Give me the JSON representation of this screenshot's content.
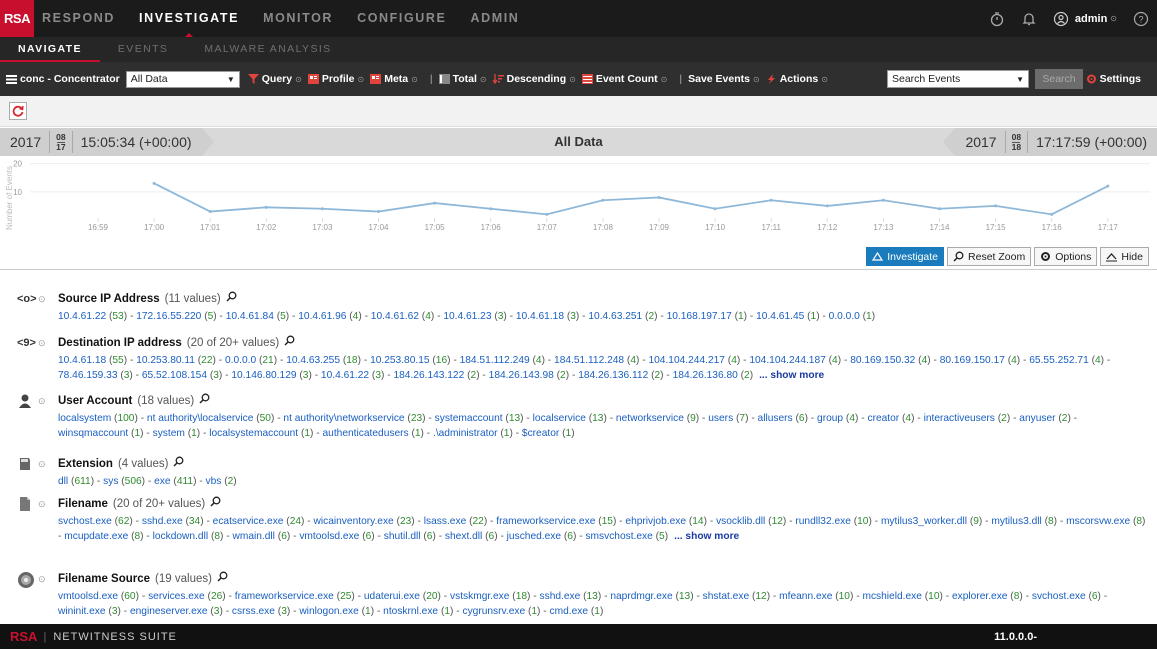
{
  "brand": {
    "logo": "RSA",
    "product": "NETWITNESS SUITE",
    "version": "11.0.0.0-"
  },
  "topnav": {
    "tabs": [
      {
        "label": "RESPOND",
        "active": false
      },
      {
        "label": "INVESTIGATE",
        "active": true
      },
      {
        "label": "MONITOR",
        "active": false
      },
      {
        "label": "CONFIGURE",
        "active": false
      },
      {
        "label": "ADMIN",
        "active": false
      }
    ],
    "user": "admin"
  },
  "subnav": {
    "tabs": [
      {
        "label": "NAVIGATE",
        "active": true
      },
      {
        "label": "EVENTS",
        "active": false
      },
      {
        "label": "MALWARE ANALYSIS",
        "active": false
      }
    ]
  },
  "toolbar": {
    "device": "conc - Concentrator",
    "data_select": "All Data",
    "query": "Query",
    "profile": "Profile",
    "meta": "Meta",
    "total": "Total",
    "order": "Descending",
    "event_count": "Event Count",
    "save_events": "Save Events",
    "actions": "Actions",
    "search_placeholder": "Search Events",
    "search_button": "Search",
    "settings": "Settings"
  },
  "timebar": {
    "start": {
      "year": "2017",
      "month": "08",
      "day": "17",
      "time": "15:05:34 (+00:00)"
    },
    "end": {
      "year": "2017",
      "month": "08",
      "day": "18",
      "time": "17:17:59 (+00:00)"
    },
    "center_label": "All Data"
  },
  "chart_data": {
    "type": "line",
    "ylabel": "Number of Events",
    "yticks": [
      10,
      20
    ],
    "ylim": [
      0,
      22
    ],
    "x": [
      "16:59",
      "17:00",
      "17:01",
      "17:02",
      "17:03",
      "17:04",
      "17:05",
      "17:06",
      "17:07",
      "17:08",
      "17:09",
      "17:10",
      "17:11",
      "17:12",
      "17:13",
      "17:14",
      "17:15",
      "17:16",
      "17:17"
    ],
    "values": [
      null,
      13,
      3,
      4.5,
      4,
      3,
      6,
      4,
      2,
      7,
      8,
      4,
      7,
      5,
      7,
      4,
      5,
      2,
      12
    ],
    "color": "#8fb8d8"
  },
  "chart_buttons": {
    "investigate": "Investigate",
    "reset_zoom": "Reset Zoom",
    "options": "Options",
    "hide": "Hide"
  },
  "meta_groups": [
    {
      "icon": "source-ip-icon",
      "title": "Source IP Address",
      "count": "(11 values)",
      "values": [
        [
          "10.4.61.22",
          "53"
        ],
        [
          "172.16.55.220",
          "5"
        ],
        [
          "10.4.61.84",
          "5"
        ],
        [
          "10.4.61.96",
          "4"
        ],
        [
          "10.4.61.62",
          "4"
        ],
        [
          "10.4.61.23",
          "3"
        ],
        [
          "10.4.61.18",
          "3"
        ],
        [
          "10.4.63.251",
          "2"
        ],
        [
          "10.168.197.17",
          "1"
        ],
        [
          "10.4.61.45",
          "1"
        ],
        [
          "0.0.0.0",
          "1"
        ]
      ],
      "show_more": ""
    },
    {
      "icon": "destination-ip-icon",
      "title": "Destination IP address",
      "count": "(20 of 20+ values)",
      "values": [
        [
          "10.4.61.18",
          "55"
        ],
        [
          "10.253.80.11",
          "22"
        ],
        [
          "0.0.0.0",
          "21"
        ],
        [
          "10.4.63.255",
          "18"
        ],
        [
          "10.253.80.15",
          "16"
        ],
        [
          "184.51.112.249",
          "4"
        ],
        [
          "184.51.112.248",
          "4"
        ],
        [
          "104.104.244.217",
          "4"
        ],
        [
          "104.104.244.187",
          "4"
        ],
        [
          "80.169.150.32",
          "4"
        ],
        [
          "80.169.150.17",
          "4"
        ],
        [
          "65.55.252.71",
          "4"
        ],
        [
          "78.46.159.33",
          "3"
        ],
        [
          "65.52.108.154",
          "3"
        ],
        [
          "10.146.80.129",
          "3"
        ],
        [
          "10.4.61.22",
          "3"
        ],
        [
          "184.26.143.122",
          "2"
        ],
        [
          "184.26.143.98",
          "2"
        ],
        [
          "184.26.136.112",
          "2"
        ],
        [
          "184.26.136.80",
          "2"
        ]
      ],
      "show_more": "... show more"
    },
    {
      "icon": "user-icon",
      "title": "User Account",
      "count": "(18 values)",
      "values": [
        [
          "localsystem",
          "100"
        ],
        [
          "nt authority\\localservice",
          "50"
        ],
        [
          "nt authority\\networkservice",
          "23"
        ],
        [
          "systemaccount",
          "13"
        ],
        [
          "localservice",
          "13"
        ],
        [
          "networkservice",
          "9"
        ],
        [
          "users",
          "7"
        ],
        [
          "allusers",
          "6"
        ],
        [
          "group",
          "4"
        ],
        [
          "creator",
          "4"
        ],
        [
          "interactiveusers",
          "2"
        ],
        [
          "anyuser",
          "2"
        ],
        [
          "winsqmaccount",
          "1"
        ],
        [
          "system",
          "1"
        ],
        [
          "localsystemaccount",
          "1"
        ],
        [
          "authenticatedusers",
          "1"
        ],
        [
          ".\\administrator",
          "1"
        ],
        [
          "$creator",
          "1"
        ]
      ],
      "show_more": ""
    },
    {
      "icon": "extension-icon",
      "title": "Extension",
      "count": "(4 values)",
      "values": [
        [
          "dll",
          "611"
        ],
        [
          "sys",
          "506"
        ],
        [
          "exe",
          "411"
        ],
        [
          "vbs",
          "2"
        ]
      ],
      "show_more": ""
    },
    {
      "icon": "file-icon",
      "title": "Filename",
      "count": "(20 of 20+ values)",
      "values": [
        [
          "svchost.exe",
          "62"
        ],
        [
          "sshd.exe",
          "34"
        ],
        [
          "ecatservice.exe",
          "24"
        ],
        [
          "wicainventory.exe",
          "23"
        ],
        [
          "lsass.exe",
          "22"
        ],
        [
          "frameworkservice.exe",
          "15"
        ],
        [
          "ehprivjob.exe",
          "14"
        ],
        [
          "vsocklib.dll",
          "12"
        ],
        [
          "rundll32.exe",
          "10"
        ],
        [
          "mytilus3_worker.dll",
          "9"
        ],
        [
          "mytilus3.dll",
          "8"
        ],
        [
          "mscorsvw.exe",
          "8"
        ],
        [
          "mcupdate.exe",
          "8"
        ],
        [
          "lockdown.dll",
          "8"
        ],
        [
          "wmain.dll",
          "6"
        ],
        [
          "vmtoolsd.exe",
          "6"
        ],
        [
          "shutil.dll",
          "6"
        ],
        [
          "shext.dll",
          "6"
        ],
        [
          "jusched.exe",
          "6"
        ],
        [
          "smsvchost.exe",
          "5"
        ]
      ],
      "show_more": "... show more"
    },
    {
      "icon": "disk-icon",
      "title": "Filename Source",
      "count": "(19 values)",
      "values": [
        [
          "vmtoolsd.exe",
          "60"
        ],
        [
          "services.exe",
          "26"
        ],
        [
          "frameworkservice.exe",
          "25"
        ],
        [
          "udaterui.exe",
          "20"
        ],
        [
          "vstskmgr.exe",
          "18"
        ],
        [
          "sshd.exe",
          "13"
        ],
        [
          "naprdmgr.exe",
          "13"
        ],
        [
          "shstat.exe",
          "12"
        ],
        [
          "mfeann.exe",
          "10"
        ],
        [
          "mcshield.exe",
          "10"
        ],
        [
          "explorer.exe",
          "8"
        ],
        [
          "svchost.exe",
          "6"
        ],
        [
          "wininit.exe",
          "3"
        ],
        [
          "engineserver.exe",
          "3"
        ],
        [
          "csrss.exe",
          "3"
        ],
        [
          "winlogon.exe",
          "1"
        ],
        [
          "ntoskrnl.exe",
          "1"
        ],
        [
          "cygrunsrv.exe",
          "1"
        ],
        [
          "cmd.exe",
          "1"
        ]
      ],
      "show_more": ""
    }
  ]
}
